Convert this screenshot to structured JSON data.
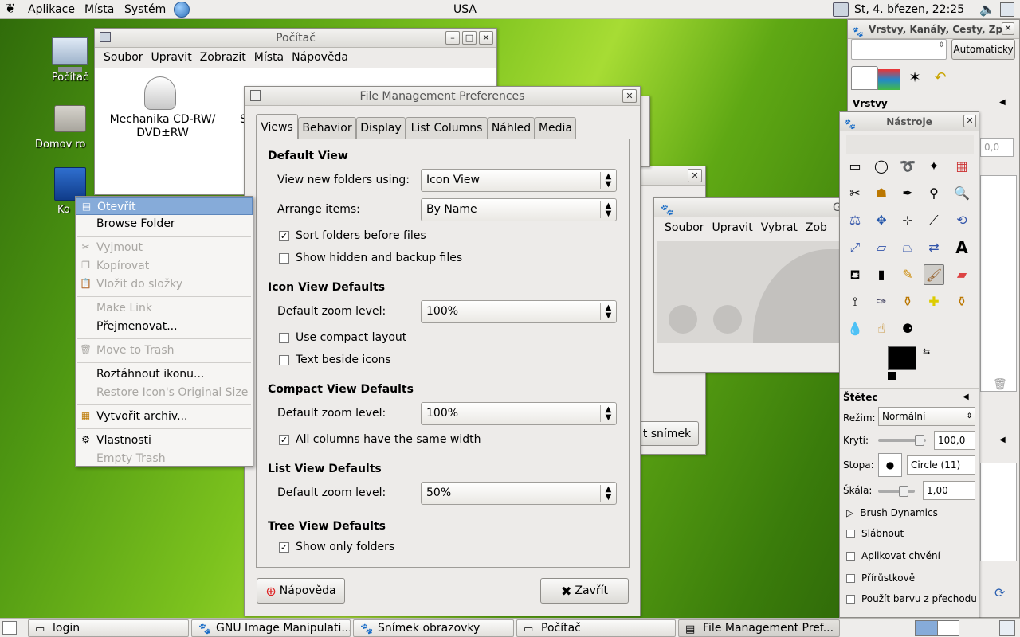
{
  "top_panel": {
    "menus": [
      "Aplikace",
      "Místa",
      "Systém"
    ],
    "keyboard_layout": "USA",
    "clock": "St,  4. březen, 22:25"
  },
  "desktop_icons": [
    {
      "label": "Počítač"
    },
    {
      "label": "Domov ro"
    },
    {
      "label": "Ko"
    }
  ],
  "computer_window": {
    "title": "Počítač",
    "menubar": [
      "Soubor",
      "Upravit",
      "Zobrazit",
      "Místa",
      "Nápověda"
    ],
    "drive_label_1": "Mechanika CD-RW/",
    "drive_label_2": "DVD±RW",
    "drive2_label": "S"
  },
  "context_menu": {
    "items": [
      {
        "label": "Otevřít",
        "state": "selected"
      },
      {
        "label": "Browse Folder",
        "state": "normal"
      },
      {
        "label": "Vyjmout",
        "state": "disabled"
      },
      {
        "label": "Kopírovat",
        "state": "disabled"
      },
      {
        "label": "Vložit do složky",
        "state": "disabled"
      },
      {
        "label": "Make Link",
        "state": "disabled"
      },
      {
        "label": "Přejmenovat...",
        "state": "normal"
      },
      {
        "label": "Move to Trash",
        "state": "disabled"
      },
      {
        "label": "Roztáhnout ikonu...",
        "state": "normal"
      },
      {
        "label": "Restore Icon's Original Size",
        "state": "disabled"
      },
      {
        "label": "Vytvořit archiv...",
        "state": "normal"
      },
      {
        "label": "Vlastnosti",
        "state": "normal"
      },
      {
        "label": "Empty Trash",
        "state": "disabled"
      }
    ]
  },
  "prefs_dialog": {
    "title": "File Management Preferences",
    "tabs": [
      "Views",
      "Behavior",
      "Display",
      "List Columns",
      "Náhled",
      "Media"
    ],
    "active_tab": "Views",
    "default_view": {
      "heading": "Default View",
      "view_label": "View new folders using:",
      "view_value": "Icon View",
      "arrange_label": "Arrange items:",
      "arrange_value": "By Name",
      "sort_folders_label": "Sort folders before files",
      "sort_folders_checked": "✓",
      "hidden_label": "Show hidden and backup files"
    },
    "icon_view": {
      "heading": "Icon View Defaults",
      "zoom_label": "Default zoom level:",
      "zoom_value": "100%",
      "compact_label": "Use compact layout",
      "beside_label": "Text beside icons"
    },
    "compact_view": {
      "heading": "Compact View Defaults",
      "zoom_label": "Default zoom level:",
      "zoom_value": "100%",
      "same_width_label": "All columns have the same width",
      "same_width_checked": "✓"
    },
    "list_view": {
      "heading": "List View Defaults",
      "zoom_label": "Default zoom level:",
      "zoom_value": "50%"
    },
    "tree_view": {
      "heading": "Tree View Defaults",
      "folders_label": "Show only folders",
      "folders_checked": "✓"
    },
    "help_button": "Nápověda",
    "close_button": "Zavřít"
  },
  "gimp_image_window": {
    "title": "G",
    "menubar": [
      "Soubor",
      "Upravit",
      "Vybrat",
      "Zob"
    ]
  },
  "screenshot_window": {
    "button": "t snímek"
  },
  "layers_dock": {
    "title": "Vrstvy, Kanály, Cesty, Zpě",
    "auto_button": "Automaticky",
    "layers_label": "Vrstvy",
    "opacity_partial": "0,0"
  },
  "toolbox": {
    "title": "Nástroje",
    "brush_section": "Štětec",
    "mode_label": "Režim:",
    "mode_value": "Normální",
    "opacity_label": "Krytí:",
    "opacity_value": "100,0",
    "brush_label": "Stopa:",
    "brush_value": "Circle (11)",
    "scale_label": "Škála:",
    "scale_value": "1,00",
    "dynamics_label": "Brush Dynamics",
    "fade_label": "Slábnout",
    "jitter_label": "Aplikovat chvění",
    "incremental_label": "Přírůstkově",
    "gradient_label": "Použít barvu z přechodu"
  },
  "taskbar": {
    "items": [
      "login",
      "GNU Image Manipulati...",
      "Snímek obrazovky",
      "Počítač",
      "File Management Pref..."
    ]
  }
}
